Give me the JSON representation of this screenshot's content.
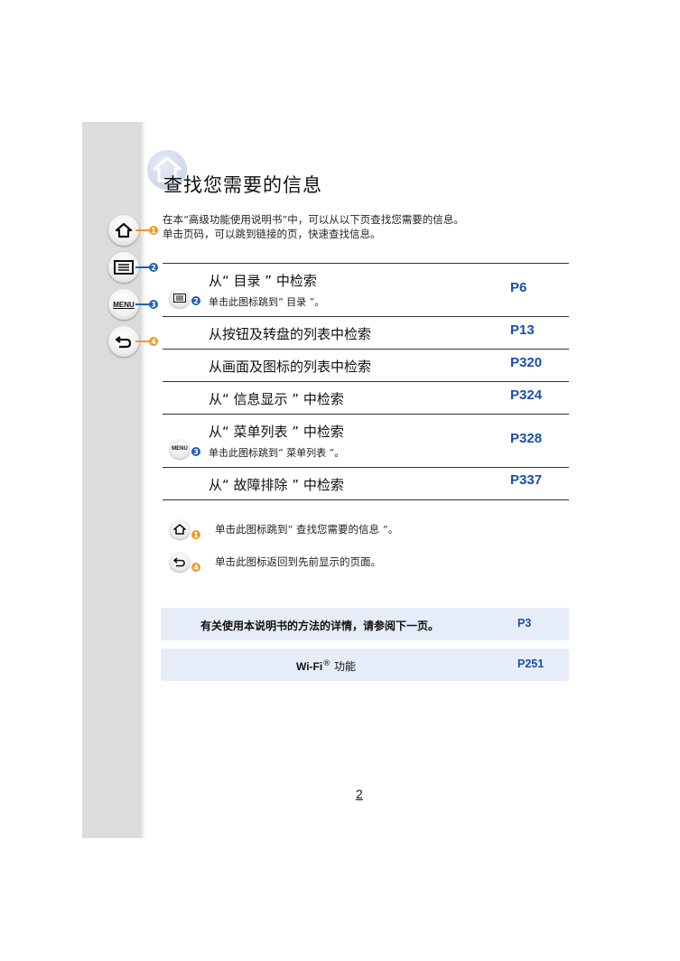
{
  "page": {
    "title": "查找您需要的信息",
    "intro_line1": "在本“高级功能使用说明书”中，可以从以下页查找您需要的信息。",
    "intro_line2": "单击页码，可以跳到链接的页，快速查找信息。",
    "page_number": "2"
  },
  "sidebar": {
    "buttons": [
      {
        "icon": "home-icon",
        "badge": "1",
        "color": "#f29a1f"
      },
      {
        "icon": "contents-list-icon",
        "badge": "2",
        "color": "#2060b0"
      },
      {
        "icon": "menu-icon",
        "label": "MENU",
        "badge": "3",
        "color": "#2060b0"
      },
      {
        "icon": "back-arrow-icon",
        "badge": "4",
        "color": "#f29a1f"
      }
    ]
  },
  "search_table": {
    "rows": [
      {
        "title": "从“ 目录 ” 中检索",
        "note": "单击此图标跳到“ 目录 ”。",
        "icon_badge": "2",
        "page": "P6"
      },
      {
        "title": "从按钮及转盘的列表中检索",
        "page": "P13"
      },
      {
        "title": "从画面及图标的列表中检索",
        "page": "P320"
      },
      {
        "title": "从“ 信息显示 ” 中检索",
        "page": "P324"
      },
      {
        "title": "从“ 菜单列表 ” 中检索",
        "note": "单击此图标跳到“ 菜单列表 ”。",
        "icon_label": "MENU",
        "icon_badge": "3",
        "page": "P328"
      },
      {
        "title": "从“ 故障排除 ” 中检索",
        "page": "P337"
      }
    ]
  },
  "legend": [
    {
      "badge": "1",
      "text": "单击此图标跳到“ 查找您需要的信息 ”。"
    },
    {
      "badge": "4",
      "text": "单击此图标返回到先前显示的页面。"
    }
  ],
  "references": [
    {
      "text": "有关使用本说明书的方法的详情，请参阅下一页。",
      "page": "P3"
    },
    {
      "text_prefix": "Wi-Fi",
      "text_mark": "®",
      "text_suffix": " 功能",
      "page": "P251"
    }
  ]
}
